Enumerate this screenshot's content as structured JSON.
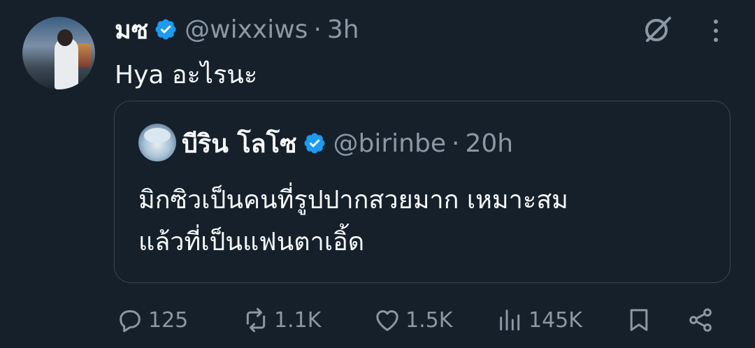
{
  "tweet": {
    "author_name": "มซ",
    "author_handle": "@wixxiws",
    "separator": "·",
    "time": "3h",
    "text": "Hya อะไรนะ",
    "avatar_icon": "profile-photo"
  },
  "quoted": {
    "author_name": "บีริน โลโซ",
    "author_handle": "@birinbe",
    "separator": "·",
    "time": "20h",
    "text_line1": "มิกซิวเป็นคนที่รูปปากสวยมาก เหมาะสม",
    "text_line2": "แล้วที่เป็นแฟนตาเอิ้ด"
  },
  "actions": {
    "replies": "125",
    "reposts": "1.1K",
    "likes": "1.5K",
    "views": "145K"
  },
  "colors": {
    "background": "#15202b",
    "text": "#f7f9f9",
    "muted": "#8b98a5",
    "verified": "#1d9bf0",
    "border": "#38444d"
  }
}
